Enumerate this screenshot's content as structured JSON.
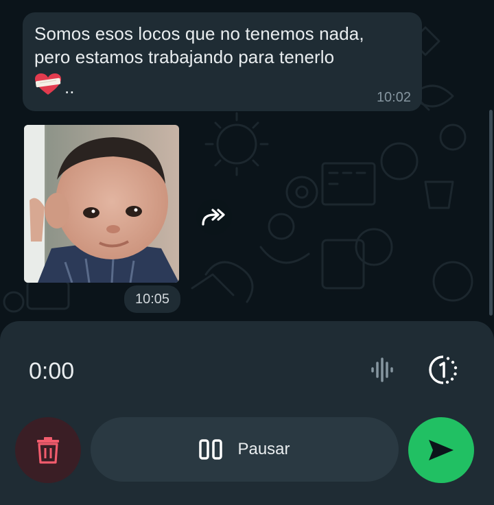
{
  "chat": {
    "text_message": {
      "line1": "Somos esos locos que no tenemos nada,",
      "line2": "pero estamos trabajando para tenerlo",
      "trailing": "..",
      "emoji": "heart-with-bandage-emoji",
      "time": "10:02"
    },
    "image_message": {
      "time": "10:05",
      "forward_icon": "forward-icon"
    }
  },
  "recorder": {
    "elapsed": "0:00",
    "waveform_icon": "waveform-icon",
    "view_once_icon": "view-once-icon",
    "delete_icon": "trash-icon",
    "pause_label": "Pausar",
    "send_icon": "send-icon"
  },
  "colors": {
    "chat_background": "#0b141a",
    "bubble": "#1f2c34",
    "send_green": "#21c063",
    "delete_red": "#f15c6d"
  }
}
